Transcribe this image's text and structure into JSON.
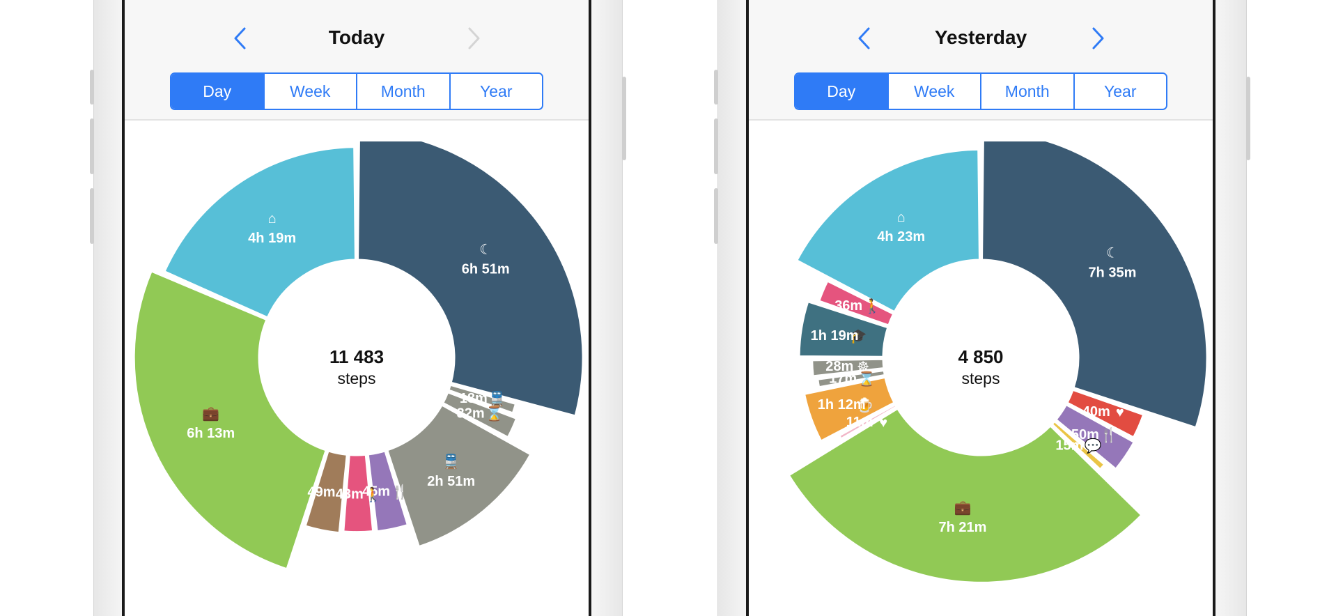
{
  "panels": [
    {
      "title": "Today",
      "prev_enabled": true,
      "next_enabled": false,
      "segments": [
        "Day",
        "Week",
        "Month",
        "Year"
      ],
      "active_segment": "Day",
      "steps_value": "11 483",
      "steps_unit": "steps",
      "slices": [
        {
          "icon": "moon-icon",
          "label": "6h 51m",
          "minutes": 411,
          "color": "#3b5a73"
        },
        {
          "icon": "train-icon",
          "label": "18m",
          "minutes": 18,
          "color": "#919389",
          "sep": "3 4"
        },
        {
          "icon": "hourglass-icon",
          "label": "32m",
          "minutes": 32,
          "color": "#919389"
        },
        {
          "icon": "train-icon",
          "label": "2h 51m",
          "minutes": 171,
          "color": "#919389"
        },
        {
          "icon": "fork-knife-icon",
          "label": "45m",
          "minutes": 45,
          "color": "#9577b9"
        },
        {
          "icon": "walking-icon",
          "label": "43m",
          "minutes": 43,
          "color": "#e5547e"
        },
        {
          "icon": "coffee-icon",
          "label": "49m",
          "minutes": 49,
          "color": "#a07c5a"
        },
        {
          "icon": "briefcase-icon",
          "label": "6h 13m",
          "minutes": 373,
          "color": "#91c955"
        },
        {
          "icon": "home-icon",
          "label": "4h 19m",
          "minutes": 259,
          "color": "#57bfd7"
        }
      ]
    },
    {
      "title": "Yesterday",
      "prev_enabled": true,
      "next_enabled": true,
      "segments": [
        "Day",
        "Week",
        "Month",
        "Year"
      ],
      "active_segment": "Day",
      "steps_value": "4 850",
      "steps_unit": "steps",
      "slices": [
        {
          "icon": "moon-icon",
          "label": "7h 35m",
          "minutes": 455,
          "color": "#3b5a73"
        },
        {
          "icon": "heart-icon",
          "label": "40m",
          "minutes": 40,
          "color": "#e24c41"
        },
        {
          "icon": "fork-knife-icon",
          "label": "50m",
          "minutes": 50,
          "color": "#9577b9"
        },
        {
          "icon": "chat-bubbles-icon",
          "label": "15m",
          "minutes": 15,
          "color": "#eac445"
        },
        {
          "icon": "briefcase-icon",
          "label": "7h 21m",
          "minutes": 441,
          "color": "#91c955"
        },
        {
          "icon": "heart-icon",
          "label": "11m",
          "minutes": 11,
          "color": "#f1b6c8"
        },
        {
          "icon": "beer-mug-icon",
          "label": "1h 12m",
          "minutes": 72,
          "color": "#efa33d"
        },
        {
          "icon": "hourglass-icon",
          "label": "17m",
          "minutes": 17,
          "color": "#919389",
          "sep": "3 4"
        },
        {
          "icon": "ship-wheel-icon",
          "label": "28m",
          "minutes": 28,
          "color": "#919389"
        },
        {
          "icon": "graduation-cap-icon",
          "label": "1h 19m",
          "minutes": 79,
          "color": "#3f7181"
        },
        {
          "icon": "walking-icon",
          "label": "36m",
          "minutes": 36,
          "color": "#e5547e"
        },
        {
          "icon": "home-icon",
          "label": "4h 23m",
          "minutes": 263,
          "color": "#57bfd7"
        }
      ]
    }
  ]
}
